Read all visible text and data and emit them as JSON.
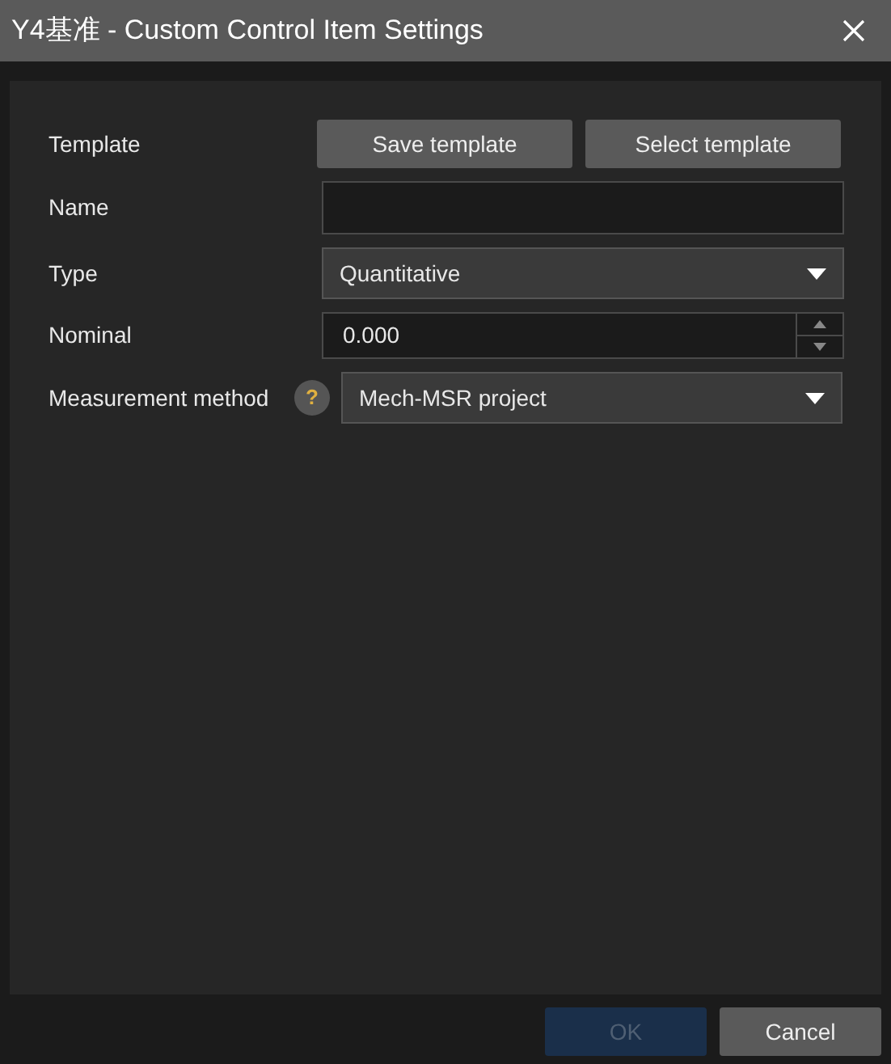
{
  "window": {
    "title": "Y4基准 - Custom Control Item Settings"
  },
  "form": {
    "template": {
      "label": "Template",
      "buttons": [
        "Save template",
        "Select template"
      ]
    },
    "name": {
      "label": "Name"
    },
    "type": {
      "label": "Type",
      "value": "Quantitative"
    },
    "nominal": {
      "label": "Nominal",
      "value": "0.000"
    },
    "method": {
      "label": "Measurement method",
      "help": "?",
      "value": "Mech-MSR project"
    }
  },
  "footer": {
    "buttons": [
      {
        "label": "OK",
        "disabled": true
      },
      {
        "label": "Cancel",
        "disabled": false
      }
    ]
  }
}
